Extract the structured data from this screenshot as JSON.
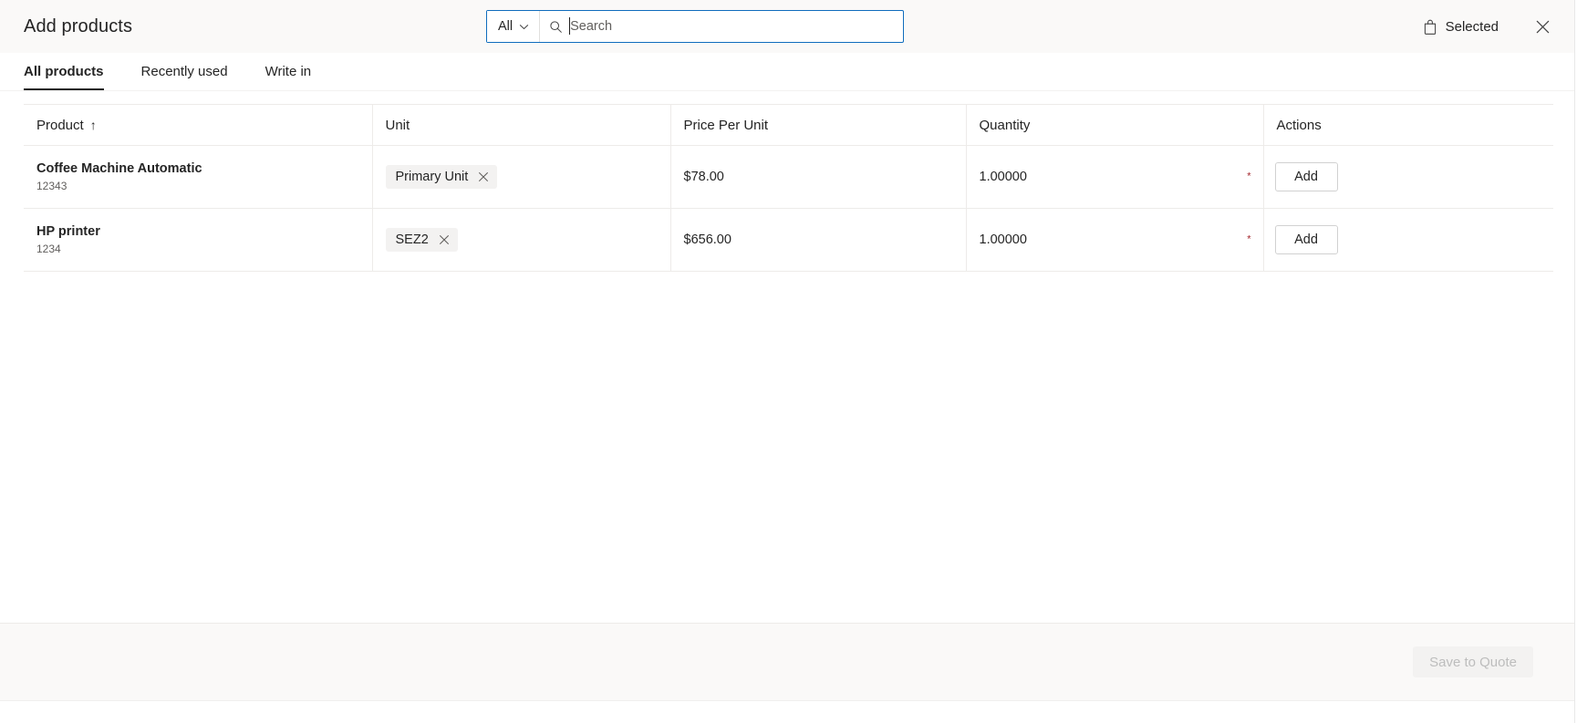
{
  "header": {
    "title": "Add products",
    "search": {
      "scope_label": "All",
      "scope_icon": "chevron-down-icon",
      "search_icon": "search-icon",
      "placeholder": "Search",
      "value": ""
    },
    "selected": {
      "label": "Selected",
      "icon": "shopping-bag-icon"
    },
    "close_icon": "close-icon"
  },
  "tabs": [
    {
      "label": "All products",
      "active": true
    },
    {
      "label": "Recently used",
      "active": false
    },
    {
      "label": "Write in",
      "active": false
    }
  ],
  "table": {
    "columns": [
      {
        "label": "Product",
        "sort_indicator": "↑"
      },
      {
        "label": "Unit",
        "sort_indicator": ""
      },
      {
        "label": "Price Per Unit",
        "sort_indicator": ""
      },
      {
        "label": "Quantity",
        "sort_indicator": ""
      },
      {
        "label": "Actions",
        "sort_indicator": ""
      }
    ],
    "rows": [
      {
        "product_name": "Coffee Machine Automatic",
        "product_sku": "12343",
        "unit_chip": "Primary Unit",
        "unit_chip_remove_icon": "close-icon",
        "price_per_unit": "$78.00",
        "quantity": "1.00000",
        "required_marker": "*",
        "action_label": "Add"
      },
      {
        "product_name": "HP printer",
        "product_sku": "1234",
        "unit_chip": "SEZ2",
        "unit_chip_remove_icon": "close-icon",
        "price_per_unit": "$656.00",
        "quantity": "1.00000",
        "required_marker": "*",
        "action_label": "Add"
      }
    ]
  },
  "footer": {
    "save_label": "Save to Quote",
    "save_enabled": false
  },
  "colors": {
    "accent": "#0f6cbd",
    "required": "#a4262c",
    "header_bg": "#faf9f8",
    "chip_bg": "#f3f2f1",
    "border": "#edebe9",
    "text": "#242424",
    "muted_text": "#605e5c"
  }
}
